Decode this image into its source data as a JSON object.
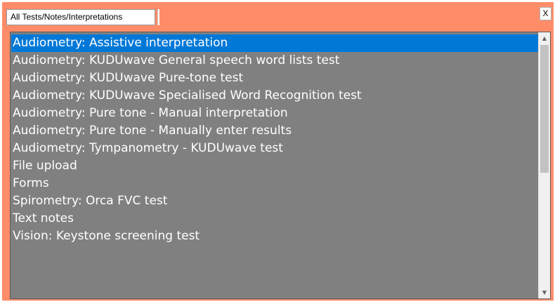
{
  "window": {
    "tab_label": "All Tests/Notes/Interpretations",
    "close_label": "X"
  },
  "colors": {
    "window_background": "#ff8c69",
    "list_background": "#808080",
    "selected_background": "#0078d7",
    "item_text": "#ffffff"
  },
  "list": {
    "selected_index": 0,
    "items": [
      "Audiometry: Assistive interpretation",
      "Audiometry: KUDUwave General speech word lists test",
      "Audiometry: KUDUwave Pure-tone test",
      "Audiometry: KUDUwave Specialised Word Recognition test",
      "Audiometry: Pure tone - Manual interpretation",
      "Audiometry: Pure tone - Manually enter results",
      "Audiometry: Tympanometry - KUDUwave test",
      "File upload",
      "Forms",
      "Spirometry: Orca FVC test",
      "Text notes",
      "Vision: Keystone screening test"
    ]
  },
  "scrollbar": {
    "up_icon": "chevron-up-icon",
    "down_icon": "chevron-down-icon"
  }
}
